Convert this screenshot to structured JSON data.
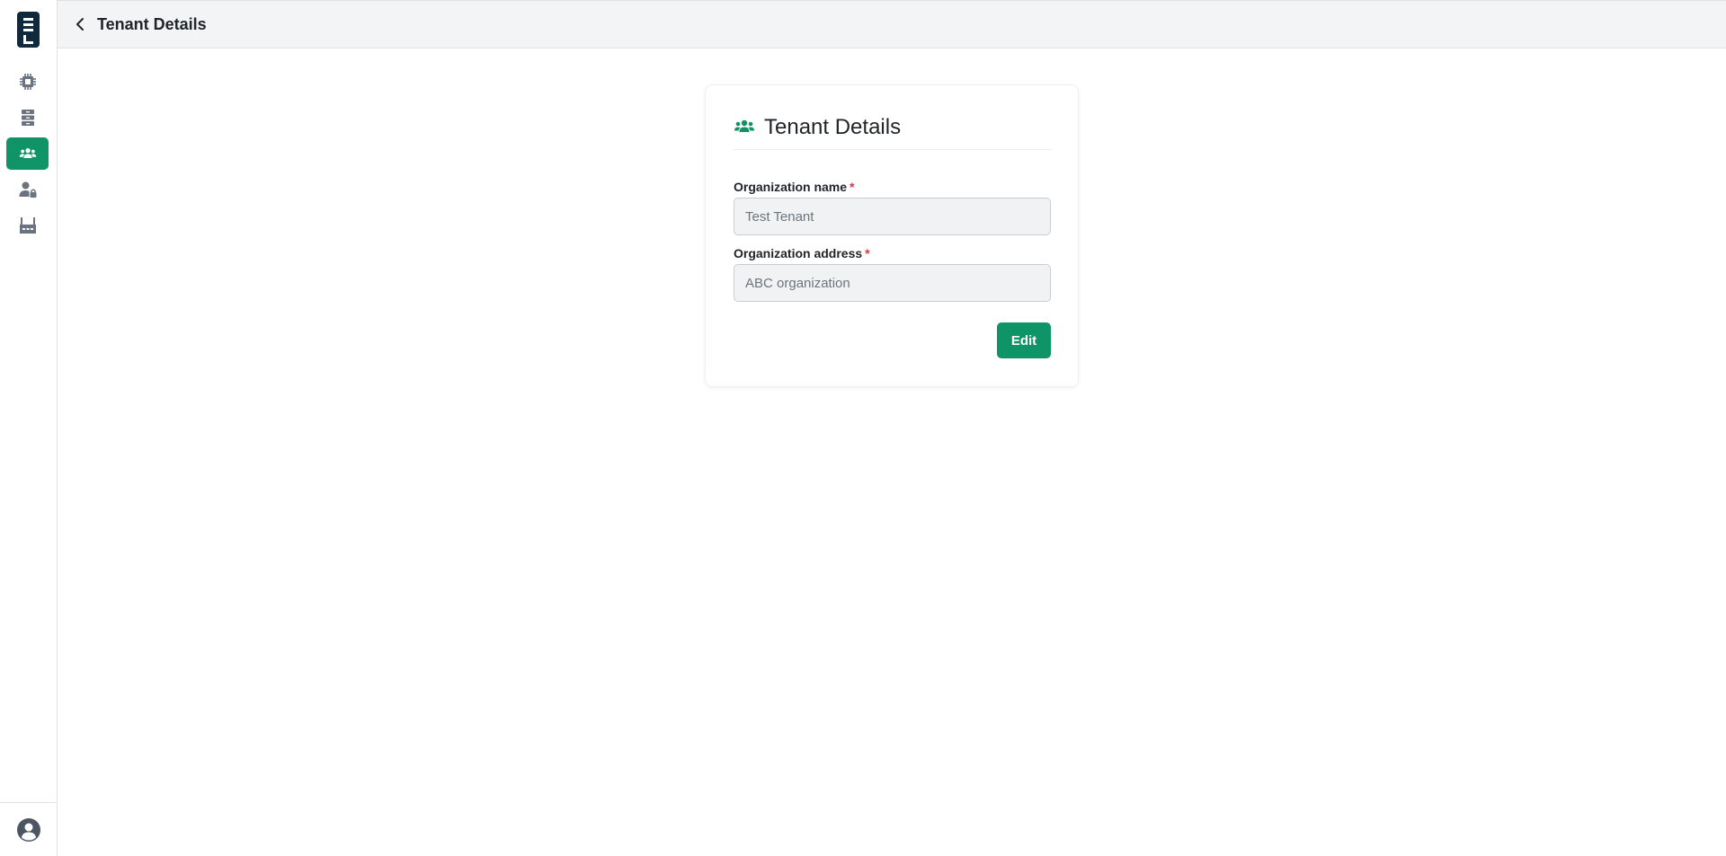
{
  "colors": {
    "accent": "#0f9467",
    "logo_bg": "#0f2a3d",
    "required": "#dc3545"
  },
  "sidebar": {
    "logo": "logo-icon",
    "items": [
      {
        "name": "chip-icon",
        "active": false
      },
      {
        "name": "server-icon",
        "active": false
      },
      {
        "name": "users-icon",
        "active": true
      },
      {
        "name": "user-lock-icon",
        "active": false
      },
      {
        "name": "factory-icon",
        "active": false
      }
    ],
    "bottom": "user-circle-icon"
  },
  "header": {
    "title": "Tenant Details",
    "back_icon": "chevron-left-icon"
  },
  "card": {
    "title": "Tenant Details",
    "icon": "users-icon",
    "fields": [
      {
        "label": "Organization name",
        "required_mark": "*",
        "value": "Test Tenant"
      },
      {
        "label": "Organization address",
        "required_mark": "*",
        "value": "ABC organization"
      }
    ],
    "edit_label": "Edit"
  }
}
